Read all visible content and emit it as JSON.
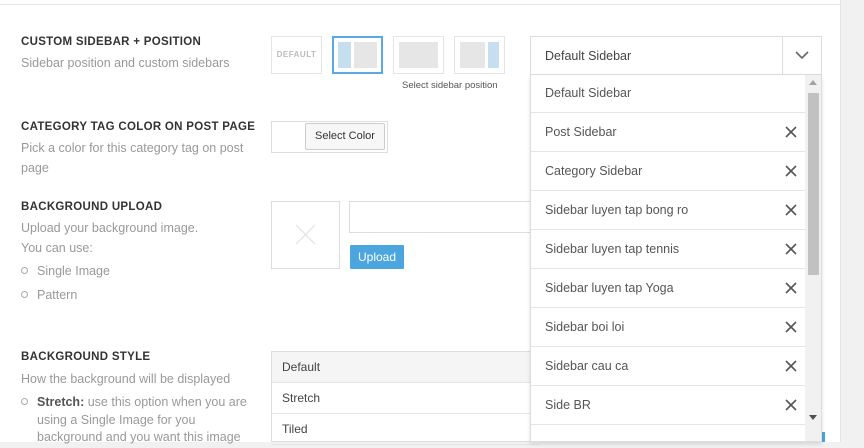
{
  "rows": {
    "sidebar": {
      "title": "CUSTOM SIDEBAR + POSITION",
      "desc": "Sidebar position and custom sidebars",
      "layout_options": [
        "DEFAULT",
        "left-sidebar",
        "no-sidebar",
        "right-sidebar"
      ],
      "selected_layout": "left-sidebar",
      "caption": "Select sidebar position"
    },
    "category_color": {
      "title": "CATEGORY TAG COLOR ON POST PAGE",
      "desc_line1": "Pick a color for this category tag on post",
      "desc_line2": "page",
      "button": "Select Color"
    },
    "bg_upload": {
      "title": "BACKGROUND UPLOAD",
      "desc_line1": "Upload your background image.",
      "desc_line2": "You can use:",
      "bullets": [
        "Single Image",
        "Pattern"
      ],
      "button": "Upload"
    },
    "bg_style": {
      "title": "BACKGROUND STYLE",
      "desc": "How the background will be displayed",
      "bullet_strong": "Stretch:",
      "bullet_text1": "use this option when you are",
      "bullet_text2": "using a Single Image for you",
      "bullet_text3": "background and you want this image",
      "options": [
        "Default",
        "Stretch",
        "Tiled"
      ],
      "selected": "Default"
    }
  },
  "sidebar_select": {
    "value": "Default Sidebar",
    "options": [
      {
        "label": "Default Sidebar",
        "removable": false
      },
      {
        "label": "Post Sidebar",
        "removable": true
      },
      {
        "label": "Category Sidebar",
        "removable": true
      },
      {
        "label": "Sidebar luyen tap bong ro",
        "removable": true
      },
      {
        "label": "Sidebar luyen tap tennis",
        "removable": true
      },
      {
        "label": "Sidebar luyen tap Yoga",
        "removable": true
      },
      {
        "label": "Sidebar boi loi",
        "removable": true
      },
      {
        "label": "Sidebar cau ca",
        "removable": true
      },
      {
        "label": "Side BR",
        "removable": true
      }
    ]
  },
  "colors": {
    "accent": "#4ba6e0",
    "selected_border": "#5aa9e6",
    "layout_fill": "#c5dff0",
    "layout_gray": "#e6e6e6"
  },
  "icons": {
    "dropdown_arrow": "chevron-down-icon",
    "remove": "close-icon",
    "empty_image": "x-icon"
  }
}
